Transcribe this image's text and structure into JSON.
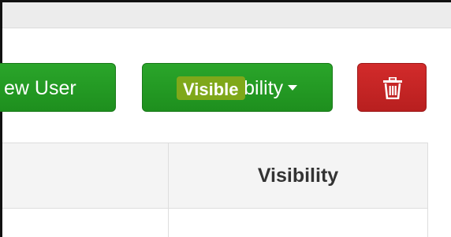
{
  "toolbar": {
    "new_user_label": "ew User",
    "set_visibility_label": "Set Visibility",
    "delete_icon": "trash-icon"
  },
  "table": {
    "columns": [
      "",
      "Visibility"
    ],
    "rows": [
      {
        "visibility": "Visible"
      }
    ]
  },
  "colors": {
    "success": "#1e8f1e",
    "danger": "#c42424",
    "badge": "#7fa81a"
  }
}
